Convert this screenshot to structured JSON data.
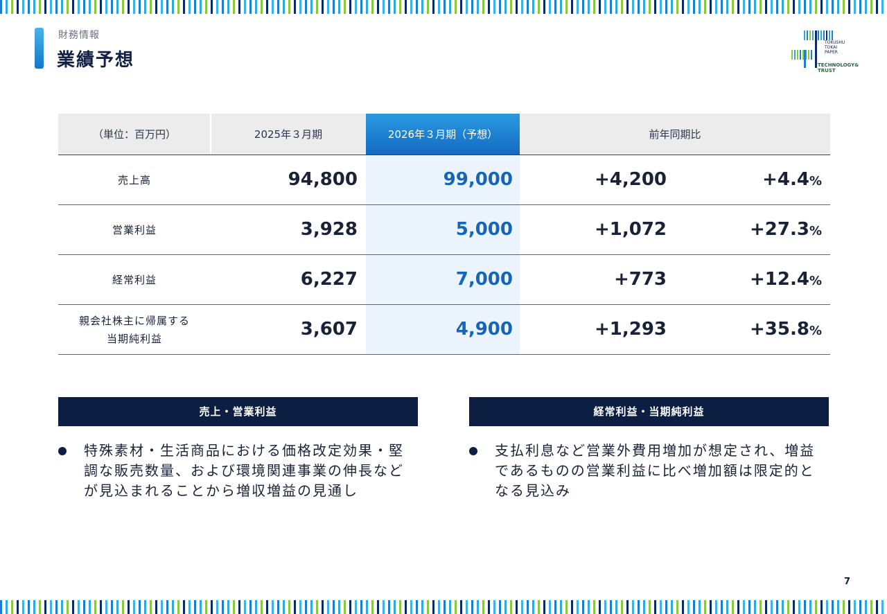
{
  "header": {
    "section": "財務情報",
    "title": "業績予想"
  },
  "logo": {
    "line1": "TOKUSHU",
    "line2": "TOKAI",
    "line3": "PAPER",
    "tagline1": "TECHNOLOGY&",
    "tagline2": "TRUST",
    "colors": [
      "#1a7fd0",
      "#2aa8e0",
      "#8cc63f",
      "#0b2a66"
    ]
  },
  "table": {
    "headers": {
      "unit": "（単位：百万円）",
      "fy2025": "2025年３月期",
      "fy2026": "2026年３月期（予想）",
      "yoy": "前年同期比"
    },
    "rows": [
      {
        "label": "売上高",
        "fy2025": "94,800",
        "fy2026": "99,000",
        "diff": "+4,200",
        "pct": "+4.4"
      },
      {
        "label": "営業利益",
        "fy2025": "3,928",
        "fy2026": "5,000",
        "diff": "+1,072",
        "pct": "+27.3"
      },
      {
        "label": "経常利益",
        "fy2025": "6,227",
        "fy2026": "7,000",
        "diff": "+773",
        "pct": "+12.4"
      },
      {
        "label": "親会社株主に帰属する\n当期純利益",
        "fy2025": "3,607",
        "fy2026": "4,900",
        "diff": "+1,293",
        "pct": "+35.8"
      }
    ],
    "pct_symbol": "%"
  },
  "boxes": {
    "left": {
      "title": "売上・営業利益",
      "text": "特殊素材・生活商品における価格改定効果・堅調な販売数量、および環境関連事業の伸長などが見込まれることから増収増益の見通し"
    },
    "right": {
      "title": "経常利益・当期純利益",
      "text": "支払利息など営業外費用増加が想定され、増益であるものの営業利益に比べ増加額は限定的となる見込み"
    }
  },
  "page_number": "7",
  "colors": {
    "accent": "#1566b8",
    "navy": "#0c1f42",
    "highlight_bg": "#ebf3fc"
  }
}
